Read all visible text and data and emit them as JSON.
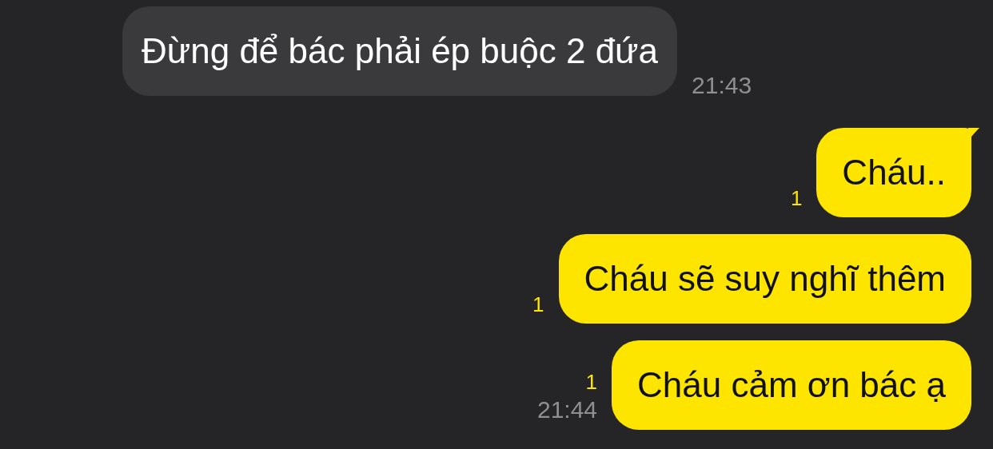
{
  "messages": [
    {
      "kind": "incoming",
      "text": "Đừng để bác phải ép buộc 2 đứa",
      "time": "21:43",
      "tail": false
    },
    {
      "kind": "outgoing",
      "text": "Cháu..",
      "unread": "1",
      "tail": true
    },
    {
      "kind": "outgoing",
      "text": "Cháu sẽ suy nghĩ thêm",
      "unread": "1",
      "tail": false
    },
    {
      "kind": "outgoing",
      "text": "Cháu cảm ơn bác ạ",
      "unread": "1",
      "time": "21:44",
      "tail": false
    }
  ]
}
